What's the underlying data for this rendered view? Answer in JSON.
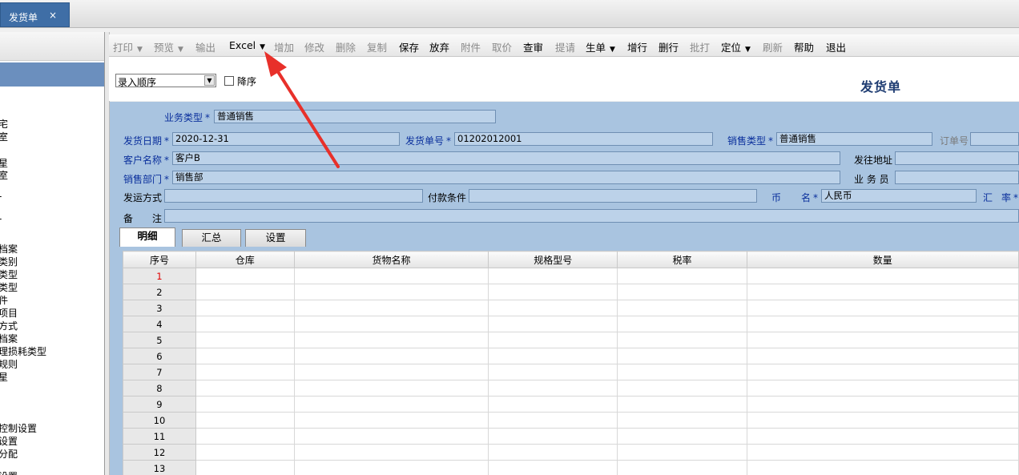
{
  "window_tab": {
    "title": "发货单",
    "close": "×"
  },
  "left_nav": {
    "items": [
      "                                                "
    ],
    "partial_labels": [
      "档案",
      "类别",
      "类型",
      "类型",
      "件",
      "项目",
      "方式",
      "档案",
      "理损耗类型",
      "规则",
      "星",
      "控制设置",
      "设置",
      "分配",
      "设置"
    ]
  },
  "toolbar": {
    "print": "打印",
    "preview": "预览",
    "output": "输出",
    "excel": "Excel",
    "add": "增加",
    "modify": "修改",
    "delete": "删除",
    "copy": "复制",
    "save": "保存",
    "abandon": "放弃",
    "attach": "附件",
    "fetch_price": "取价",
    "review": "查审",
    "request": "提请",
    "generate": "生单",
    "add_row": "增行",
    "delete_row": "删行",
    "batch_print": "批打",
    "locate": "定位",
    "refresh": "刷新",
    "help": "帮助",
    "exit": "退出",
    "dropdown_glyph": "▼"
  },
  "sort": {
    "value": "录入顺序",
    "descending_label": "降序"
  },
  "document_title": "发货单",
  "form": {
    "business_type": {
      "label": "业务类型",
      "value": "普通销售"
    },
    "ship_date": {
      "label": "发货日期",
      "value": "2020-12-31"
    },
    "ship_no": {
      "label": "发货单号",
      "value": "01202012001"
    },
    "sales_type": {
      "label": "销售类型",
      "value": "普通销售"
    },
    "order_no": {
      "label": "订单号",
      "value": ""
    },
    "customer": {
      "label": "客户名称",
      "value": "客户B"
    },
    "ship_address": {
      "label": "发往地址",
      "value": ""
    },
    "sales_dept": {
      "label": "销售部门",
      "value": "销售部"
    },
    "salesperson": {
      "label": "业 务 员",
      "value": ""
    },
    "ship_method": {
      "label": "发运方式",
      "value": ""
    },
    "payment_terms": {
      "label": "付款条件",
      "value": ""
    },
    "currency": {
      "label_a": "币",
      "label_b": "名",
      "value": "人民币"
    },
    "exchange_rate": {
      "label_a": "汇",
      "label_b": "率"
    },
    "remark": {
      "label_a": "备",
      "label_b": "注",
      "value": ""
    },
    "required_mark": "*"
  },
  "subtabs": [
    "明细",
    "汇总",
    "设置"
  ],
  "grid": {
    "columns": [
      "序号",
      "仓库",
      "货物名称",
      "规格型号",
      "税率",
      "数量"
    ],
    "rows": [
      "1",
      "2",
      "3",
      "4",
      "5",
      "6",
      "7",
      "8",
      "9",
      "10",
      "11",
      "12",
      "13"
    ]
  },
  "colors": {
    "accent": "#3f6ea6",
    "form_bg": "#a9c4e0",
    "label_blue": "#0a2f9c",
    "annotation_arrow": "#e8302a"
  }
}
